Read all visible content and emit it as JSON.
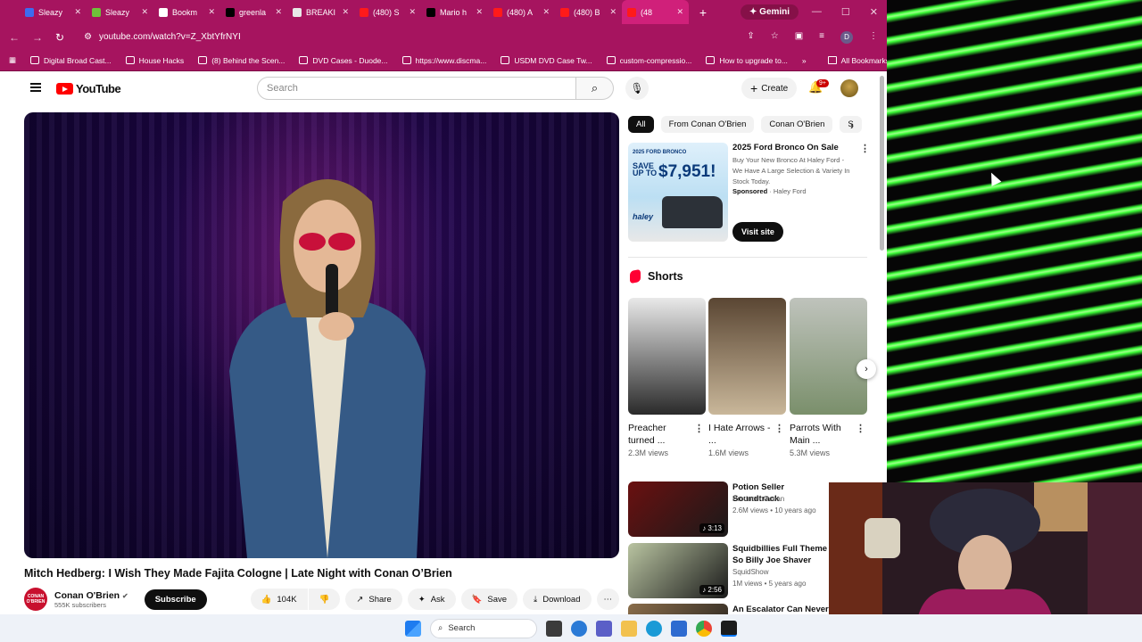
{
  "browser": {
    "tabs": [
      {
        "label": "Sleazy",
        "color": "#3d6cf0"
      },
      {
        "label": "Sleazy",
        "color": "#6fc23a"
      },
      {
        "label": "Bookm",
        "color": "#ffffff"
      },
      {
        "label": "greenla",
        "color": "#000000"
      },
      {
        "label": "BREAKI",
        "color": "#e8e8e8"
      },
      {
        "label": "(480) S",
        "color": "#ff1a1a"
      },
      {
        "label": "Mario h",
        "color": "#000000"
      },
      {
        "label": "(480) A",
        "color": "#ff1a1a"
      },
      {
        "label": "(480) B",
        "color": "#ff1a1a"
      },
      {
        "label": "(48",
        "color": "#ff1a1a",
        "active": true
      }
    ],
    "gemini_label": "Gemini",
    "url": "youtube.com/watch?v=Z_XbtYfrNYI",
    "profile_letter": "D",
    "bookmarks": [
      "Digital Broad Cast...",
      "House Hacks",
      "(8) Behind the Scen...",
      "DVD Cases - Duode...",
      "https://www.discma...",
      "USDM DVD Case Tw...",
      "custom-compressio...",
      "How to upgrade to..."
    ],
    "all_bookmarks": "All Bookmarks"
  },
  "youtube": {
    "logo_text": "YouTube",
    "search_placeholder": "Search",
    "create_label": "Create",
    "notif_badge": "9+",
    "video_title": "Mitch Hedberg: I Wish They Made Fajita Cologne | Late Night with Conan O’Brien",
    "channel_avatar_text": "CONAN O'BRIEN",
    "channel_name": "Conan O'Brien",
    "subscribers": "555K subscribers",
    "subscribe_label": "Subscribe",
    "likes": "104K",
    "share_label": "Share",
    "ask_label": "Ask",
    "save_label": "Save",
    "download_label": "Download",
    "chips": [
      "All",
      "From Conan O'Brien",
      "Conan O'Brien",
      "S"
    ],
    "ad": {
      "thumb_line1": "2025 FORD BRONCO",
      "thumb_save": "SAVE UP TO",
      "thumb_price": "$7,951!",
      "thumb_logo": "haley",
      "title": "2025 Ford Bronco On Sale",
      "desc": "Buy Your New Bronco At Haley Ford - We Have A Large Selection & Variety In Stock Today.",
      "sponsored": "Sponsored",
      "advertiser": "Haley Ford",
      "visit_label": "Visit site"
    },
    "shorts_label": "Shorts",
    "shorts": [
      {
        "title": "Preacher turned ...",
        "views": "2.3M views",
        "colors": [
          "#e9e9e9",
          "#2a2a2a"
        ]
      },
      {
        "title": "I Hate Arrows - ...",
        "views": "1.6M views",
        "colors": [
          "#5a4633",
          "#c9b79a"
        ]
      },
      {
        "title": "Parrots With Main ...",
        "views": "5.3M views",
        "colors": [
          "#bfc3bc",
          "#7a8f6b"
        ]
      }
    ],
    "recommended": [
      {
        "title": "Potion Seller Soundtrack",
        "channel": "Producer Ocean",
        "meta": "2.6M views • 10 years ago",
        "duration": "3:13",
        "color": "#6a1010"
      },
      {
        "title": "Squidbillies Full Theme So Billy Joe Shaver",
        "channel": "SquidShow",
        "meta": "1M views • 5 years ago",
        "duration": "2:56",
        "color": "#b9c4a1"
      },
      {
        "title": "An Escalator Can Never Br",
        "channel": "",
        "meta": "",
        "duration": "",
        "color": "#8a6d4a"
      }
    ]
  },
  "taskbar": {
    "search_label": "Search"
  }
}
